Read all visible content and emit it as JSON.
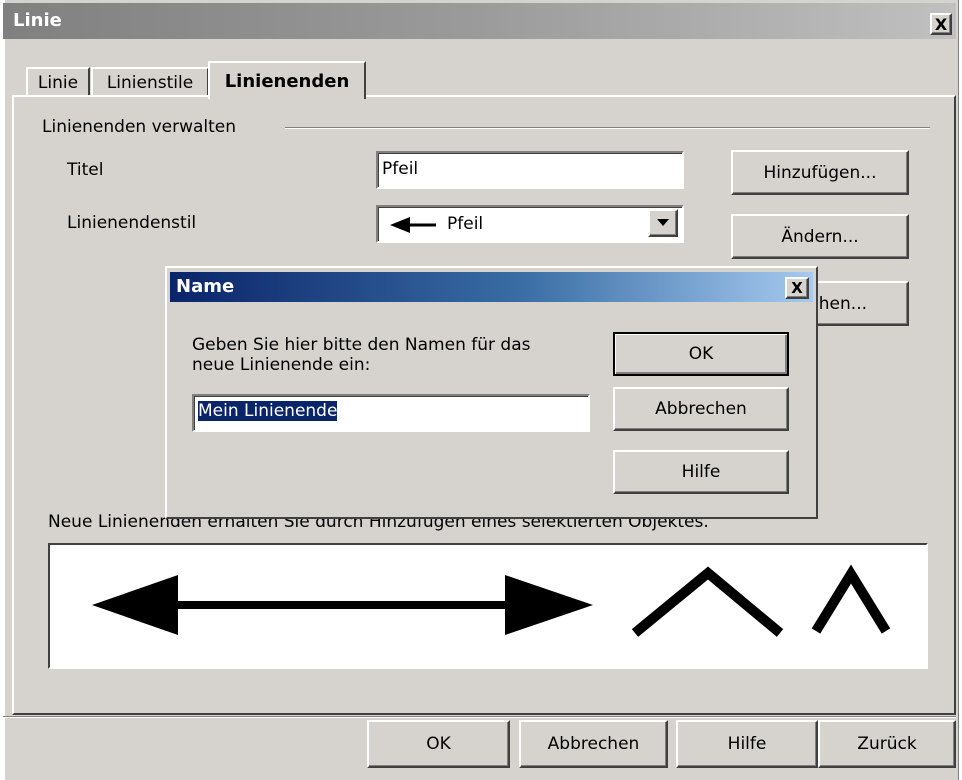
{
  "window": {
    "title": "Linie",
    "close_glyph": "X"
  },
  "tabs": [
    {
      "label": "Linie",
      "active": false
    },
    {
      "label": "Linienstile",
      "active": false
    },
    {
      "label": "Linienenden",
      "active": true
    }
  ],
  "group": {
    "title": "Linienenden verwalten",
    "title_label": "Titel",
    "title_value": "Pfeil",
    "style_label": "Linienendenstil",
    "style_value": "Pfeil",
    "hint": "Neue Linienenden erhalten Sie durch Hinzufügen eines selektierten Objektes."
  },
  "side_buttons": {
    "add": "Hinzufügen...",
    "modify": "Ändern...",
    "delete": "Löschen..."
  },
  "name_dialog": {
    "title": "Name",
    "close_glyph": "X",
    "prompt_line1": "Geben Sie hier bitte den Namen für das",
    "prompt_line2": "neue Linienende ein:",
    "input_value": "Mein Linienende",
    "ok": "OK",
    "cancel": "Abbrechen",
    "help": "Hilfe"
  },
  "footer": {
    "ok": "OK",
    "cancel": "Abbrechen",
    "help": "Hilfe",
    "back": "Zurück"
  },
  "preview": {
    "items": [
      "arrow-left-head-icon",
      "arrow-right-head-icon",
      "chevron-wide-icon",
      "chevron-narrow-icon"
    ]
  },
  "colors": {
    "face": "#d6d3ce",
    "active_title": "#0a246a",
    "inactive_title": "#808080"
  }
}
